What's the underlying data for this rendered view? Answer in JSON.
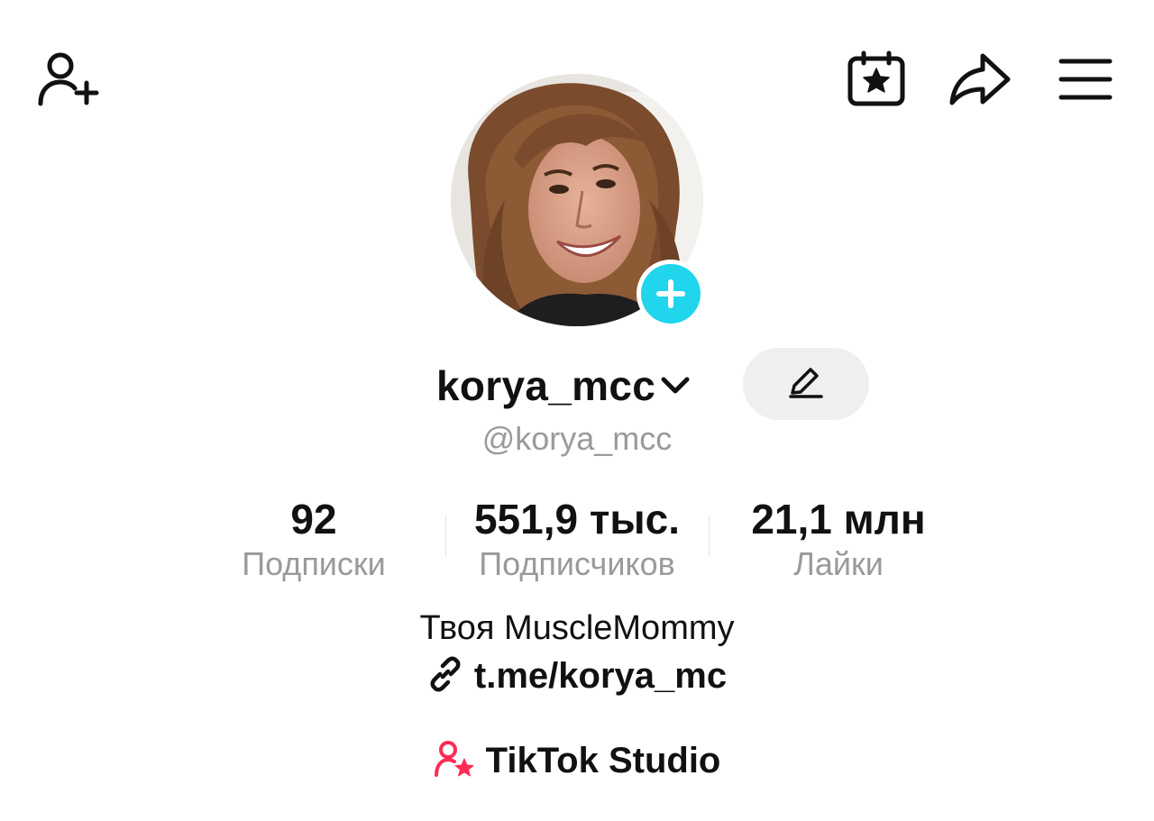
{
  "header": {
    "left_icon": "add-friend-icon",
    "right_icons": [
      "calendar-star-icon",
      "share-icon",
      "menu-icon"
    ]
  },
  "profile": {
    "avatar": "profile-photo",
    "display_name": "korya_mcc",
    "handle": "@korya_mcc",
    "bio": "Твоя MuscleMommy",
    "link": "t.me/korya_mc",
    "studio_label": "TikTok Studio"
  },
  "stats": [
    {
      "value": "92",
      "label": "Подписки"
    },
    {
      "value": "551,9 тыс.",
      "label": "Подписчиков"
    },
    {
      "value": "21,1 млн",
      "label": "Лайки"
    }
  ],
  "colors": {
    "accent_cyan": "#20d5ec",
    "studio_pink": "#fe2c55",
    "text_primary": "#111111",
    "text_secondary": "#9a9a9a",
    "edit_bg": "#efefef"
  }
}
